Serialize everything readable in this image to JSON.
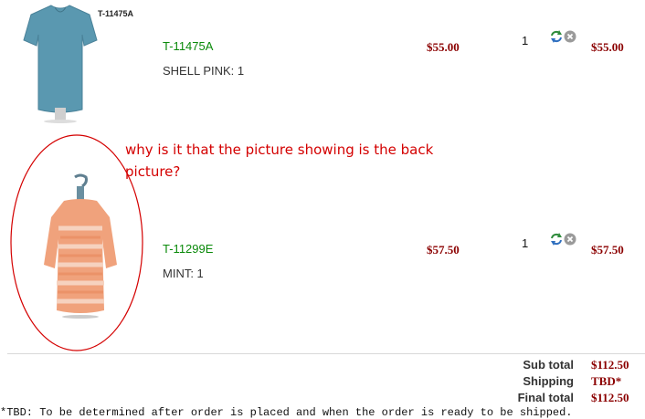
{
  "cart": {
    "items": [
      {
        "image_tag": "T-11475A",
        "sku": "T-11475A",
        "variant": "SHELL PINK: 1",
        "price": "$55.00",
        "qty": "1",
        "line_total": "$55.00",
        "garment_color": "#5a98b0"
      },
      {
        "sku": "T-11299E",
        "variant": "MINT: 1",
        "price": "$57.50",
        "qty": "1",
        "line_total": "$57.50",
        "garment_color": "#f0a27c"
      }
    ]
  },
  "annotation": {
    "line1": "why is it that the picture showing is the back",
    "line2": "picture?",
    "color": "#d40000"
  },
  "summary": {
    "subtotal_label": "Sub total",
    "subtotal_value": "$112.50",
    "shipping_label": "Shipping",
    "shipping_value": "TBD*",
    "final_label": "Final total",
    "final_value": "$112.50"
  },
  "footnote": "*TBD: To be determined after order is  placed and when the order is ready to be shipped.",
  "icons": {
    "update": "refresh-icon",
    "remove": "remove-icon"
  }
}
